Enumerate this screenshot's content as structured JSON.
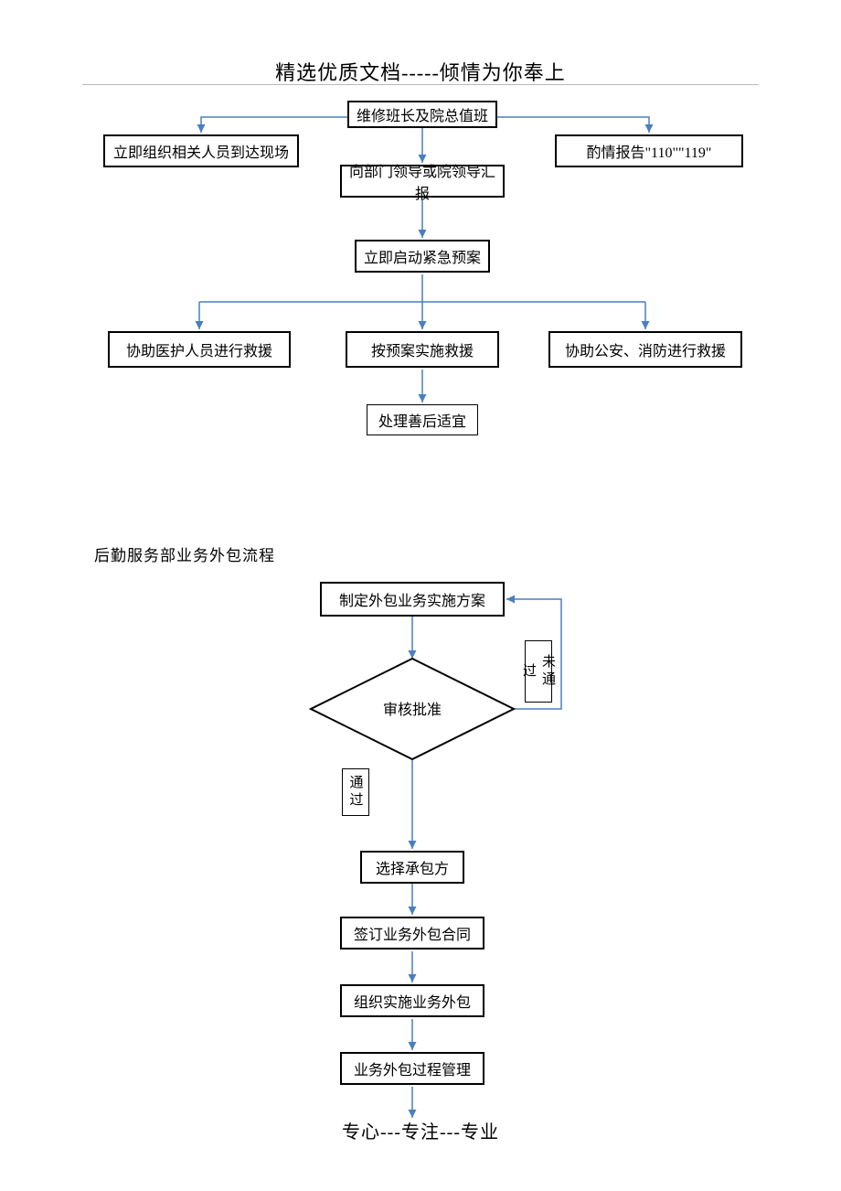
{
  "header": "精选优质文档-----倾情为你奉上",
  "footer": "专心---专注---专业",
  "flow1": {
    "n1": "维修班长及院总值班",
    "n2_left": "立即组织相关人员到达现场",
    "n2_right": "酌情报告\"110\"\"119\"",
    "n3": "向部门领导或院领导汇报",
    "n4": "立即启动紧急预案",
    "n5_left": "协助医护人员进行救援",
    "n5_mid": "按预案实施救援",
    "n5_right": "协助公安、消防进行救援",
    "n6": "处理善后适宜"
  },
  "section2_title": "后勤服务部业务外包流程",
  "flow2": {
    "s1": "制定外包业务实施方案",
    "decision": "审核批准",
    "label_no": "未通过",
    "label_yes": "通过",
    "s3": "选择承包方",
    "s4": "签订业务外包合同",
    "s5": "组织实施业务外包",
    "s6": "业务外包过程管理"
  }
}
